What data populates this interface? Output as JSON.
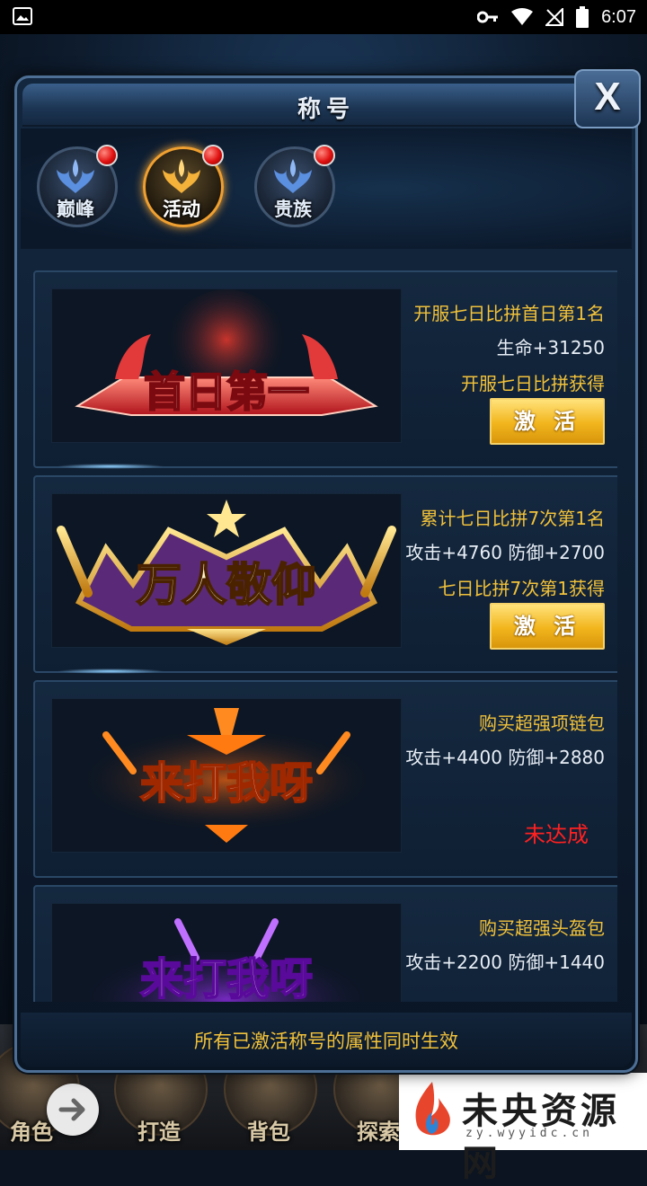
{
  "status_bar": {
    "time": "6:07",
    "icons": [
      "image-icon",
      "key-icon",
      "wifi-icon",
      "no-signal-icon",
      "battery-icon"
    ]
  },
  "background": {
    "title_text": "角色"
  },
  "panel": {
    "title": "称号",
    "close_label": "X",
    "tabs": [
      {
        "label": "巅峰",
        "icon": "peak-emblem-icon",
        "active": false,
        "has_badge": true
      },
      {
        "label": "活动",
        "icon": "event-emblem-icon",
        "active": true,
        "has_badge": true
      },
      {
        "label": "贵族",
        "icon": "noble-emblem-icon",
        "active": false,
        "has_badge": true
      }
    ],
    "titles": [
      {
        "art_text": "首日第一",
        "requirement": "开服七日比拼首日第1名",
        "stats": "生命+31250",
        "source": "开服七日比拼获得",
        "action_label": "激 活",
        "status": ""
      },
      {
        "art_text": "万人敬仰",
        "requirement": "累计七日比拼7次第1名",
        "stats": "攻击+4760 防御+2700",
        "source": "七日比拼7次第1获得",
        "action_label": "激 活",
        "status": ""
      },
      {
        "art_text": "来打我呀",
        "requirement": "购买超强项链包",
        "stats": "攻击+4400 防御+2880",
        "source": "",
        "action_label": "",
        "status": "未达成"
      },
      {
        "art_text": "来打我呀",
        "requirement": "购买超强头盔包",
        "stats": "攻击+2200 防御+1440",
        "source": "",
        "action_label": "",
        "status": ""
      }
    ],
    "footer": "所有已激活称号的属性同时生效"
  },
  "bottom_nav": {
    "items": [
      "角色",
      "打造",
      "背包",
      "探索"
    ]
  },
  "watermark": {
    "text": "未央资源网",
    "url": "zy.wyyidc.cn"
  },
  "colors": {
    "gold_text": "#f2c23a",
    "red_status": "#ff2020",
    "panel_border": "#4d6f95"
  }
}
